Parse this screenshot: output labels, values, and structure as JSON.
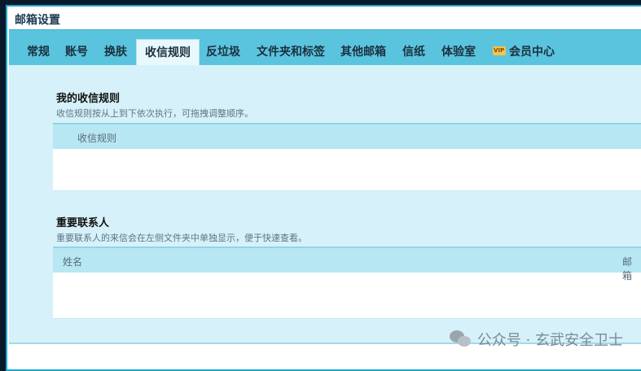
{
  "window": {
    "title": "邮箱设置"
  },
  "tabs": [
    {
      "label": "常规"
    },
    {
      "label": "账号"
    },
    {
      "label": "换肤"
    },
    {
      "label": "收信规则",
      "active": true
    },
    {
      "label": "反垃圾"
    },
    {
      "label": "文件夹和标签"
    },
    {
      "label": "其他邮箱"
    },
    {
      "label": "信纸"
    },
    {
      "label": "体验室"
    },
    {
      "label": "会员中心",
      "icon": "vip-icon"
    }
  ],
  "rules_section": {
    "title": "我的收信规则",
    "description": "收信规则按从上到下依次执行，可拖拽调整顺序。",
    "column_header": "收信规则"
  },
  "contacts_section": {
    "title": "重要联系人",
    "description": "重要联系人的来信会在左侧文件夹中单独显示，便于快速查看。",
    "column_name": "姓名",
    "column_email": "邮箱"
  },
  "watermark": {
    "text": "公众号 · 玄武安全卫士"
  },
  "colors": {
    "frame_border": "#1ea6c9",
    "tab_bar": "#5ac4de",
    "content_bg": "#d6f1f9",
    "table_header": "#b7e7f3"
  }
}
